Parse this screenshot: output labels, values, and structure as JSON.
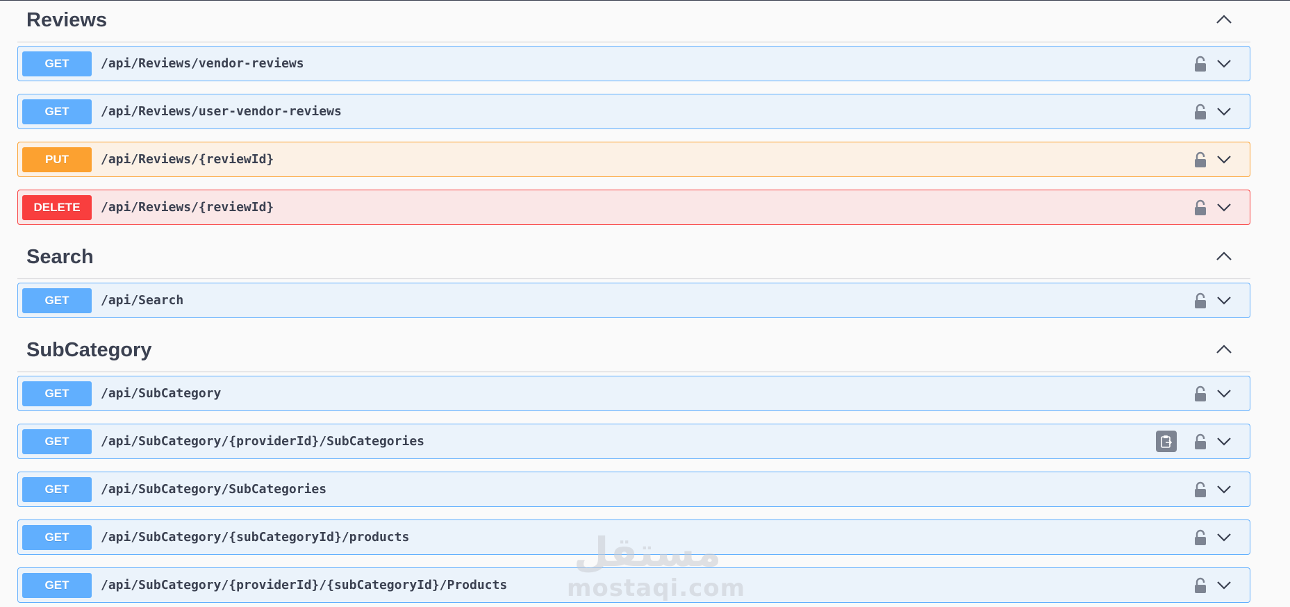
{
  "sections": [
    {
      "title": "Reviews",
      "operations": [
        {
          "method": "GET",
          "path": "/api/Reviews/vendor-reviews"
        },
        {
          "method": "GET",
          "path": "/api/Reviews/user-vendor-reviews"
        },
        {
          "method": "PUT",
          "path": "/api/Reviews/{reviewId}"
        },
        {
          "method": "DELETE",
          "path": "/api/Reviews/{reviewId}"
        }
      ]
    },
    {
      "title": "Search",
      "operations": [
        {
          "method": "GET",
          "path": "/api/Search"
        }
      ]
    },
    {
      "title": "SubCategory",
      "operations": [
        {
          "method": "GET",
          "path": "/api/SubCategory"
        },
        {
          "method": "GET",
          "path": "/api/SubCategory/{providerId}/SubCategories"
        },
        {
          "method": "GET",
          "path": "/api/SubCategory/SubCategories"
        },
        {
          "method": "GET",
          "path": "/api/SubCategory/{subCategoryId}/products"
        },
        {
          "method": "GET",
          "path": "/api/SubCategory/{providerId}/{subCategoryId}/Products"
        }
      ]
    }
  ],
  "watermark": {
    "logo": "مستقل",
    "text": "mostaqi.com"
  },
  "colors": {
    "get": "#61affe",
    "put": "#fca130",
    "delete": "#f93e3e",
    "text": "#3b4151"
  },
  "icons": {
    "collapse": "chevron-up-icon",
    "expand": "chevron-down-icon",
    "lock": "unlocked-padlock-icon",
    "copy": "copy-to-clipboard-icon"
  }
}
